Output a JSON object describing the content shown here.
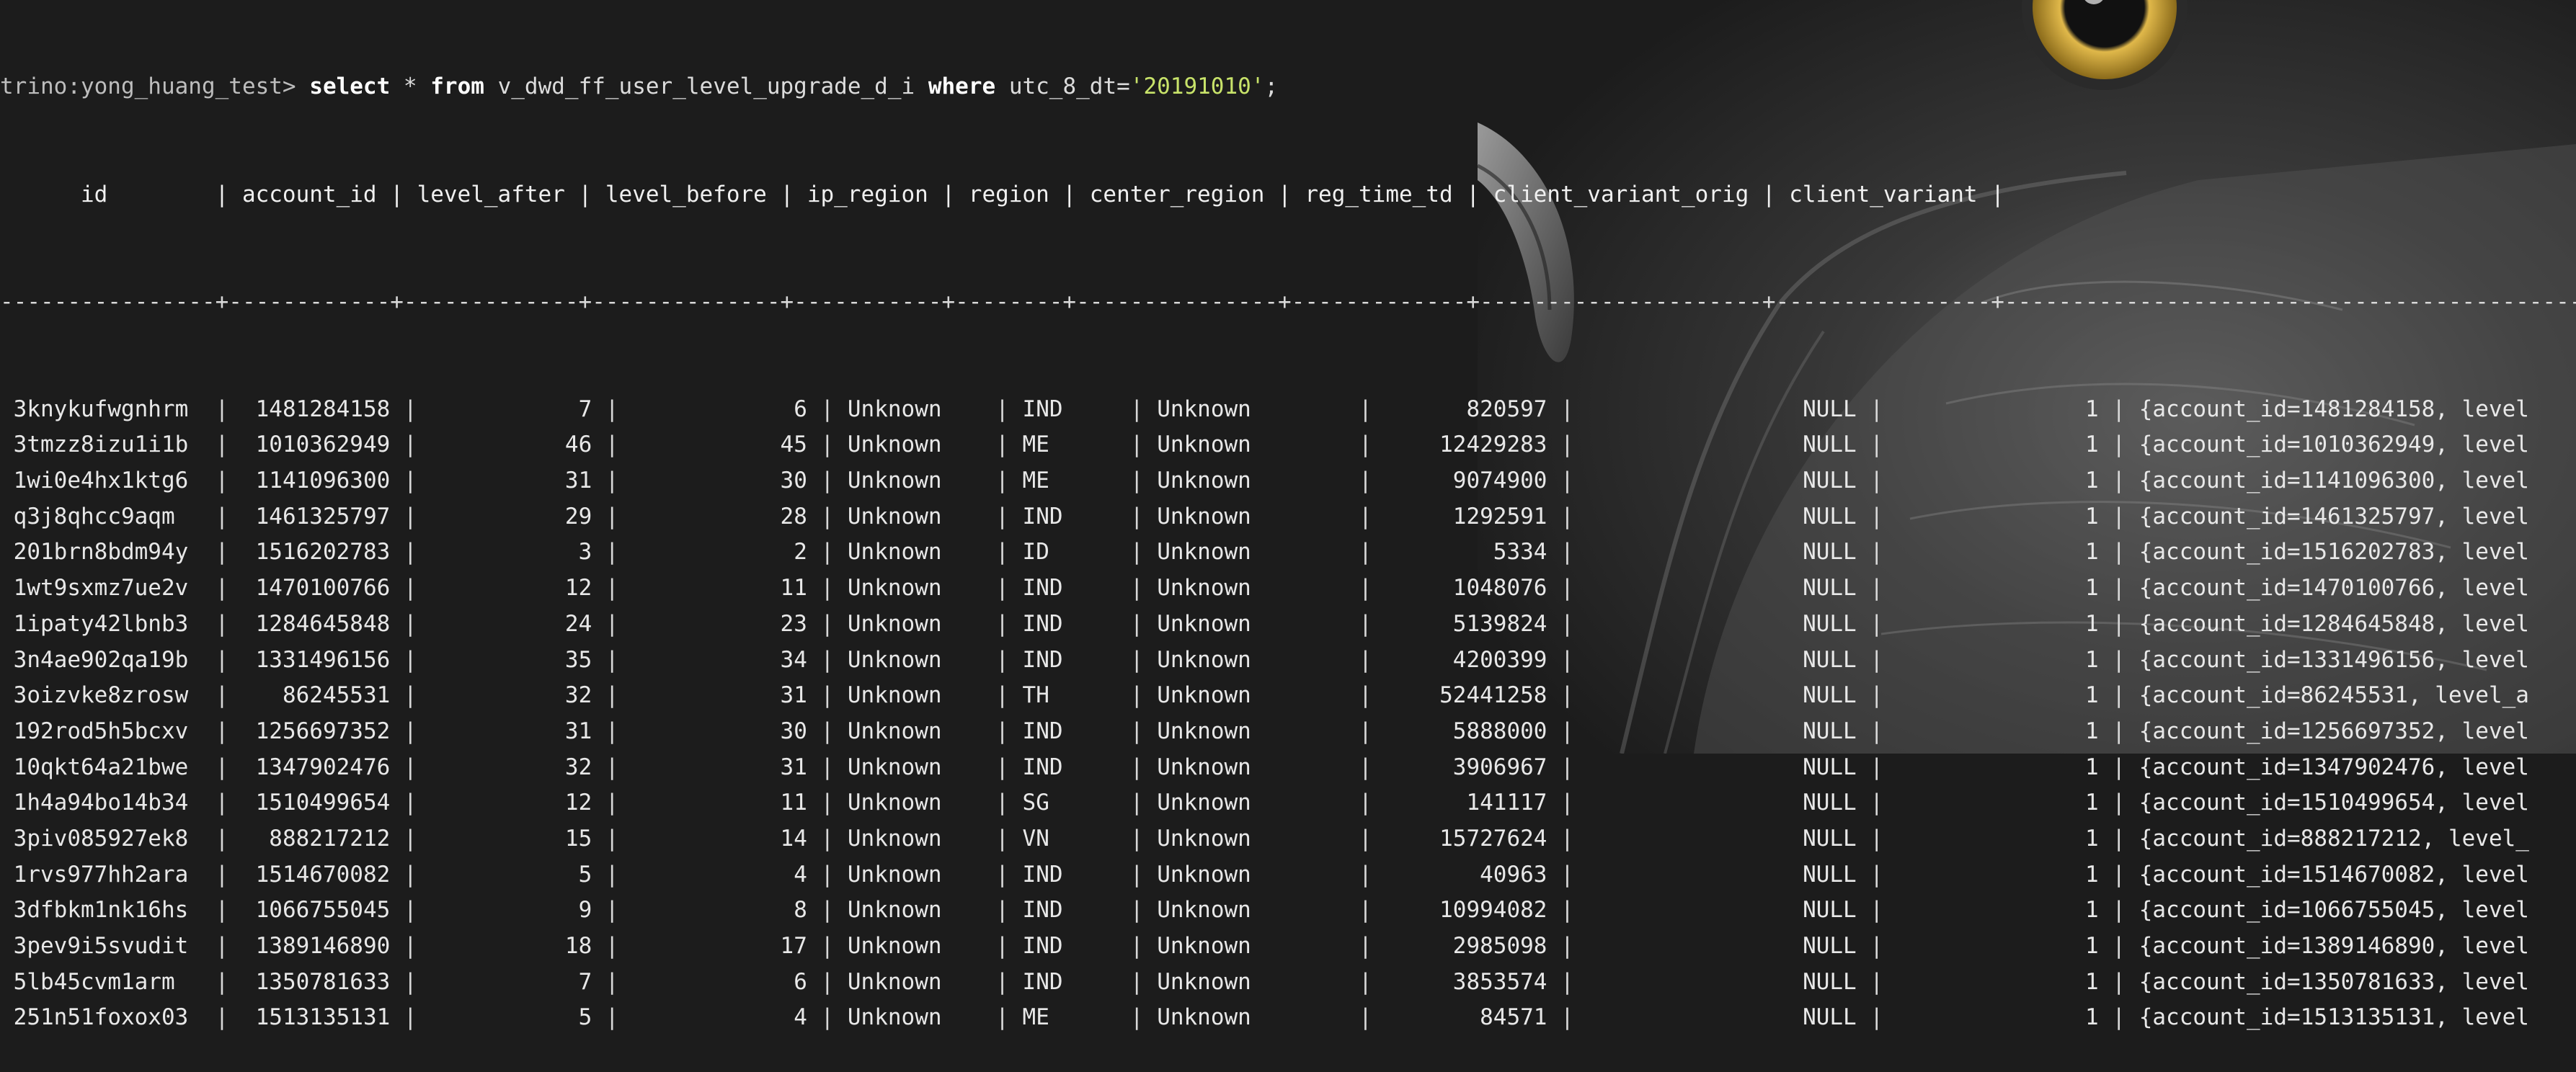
{
  "prompt": "trino:yong_huang_test>",
  "query": {
    "kw_select": "select",
    "star_from_text": " * ",
    "kw_from": "from",
    "table": " v_dwd_ff_user_level_upgrade_d_i ",
    "kw_where": "where",
    "condition": " utc_8_dt=",
    "value": "'20191010'",
    "terminator": ";"
  },
  "table": {
    "columns": [
      "id",
      "account_id",
      "level_after",
      "level_before",
      "ip_region",
      "region",
      "center_region",
      "reg_time_td",
      "client_variant_orig",
      "client_variant"
    ],
    "header_line": "      id        | account_id | level_after | level_before | ip_region | region | center_region | reg_time_td | client_variant_orig | client_variant |",
    "separator_line": "----------------+------------+-------------+--------------+-----------+--------+---------------+-------------+---------------------+----------------+-----------------------------------------------------------",
    "rows": [
      [
        "3knykufwgnhrm",
        "1481284158",
        "7",
        "6",
        "Unknown",
        "IND",
        "Unknown",
        "820597",
        "NULL",
        "1",
        "{account_id=1481284158, level"
      ],
      [
        "3tmzz8izu1i1b",
        "1010362949",
        "46",
        "45",
        "Unknown",
        "ME",
        "Unknown",
        "12429283",
        "NULL",
        "1",
        "{account_id=1010362949, level"
      ],
      [
        "1wi0e4hx1ktg6",
        "1141096300",
        "31",
        "30",
        "Unknown",
        "ME",
        "Unknown",
        "9074900",
        "NULL",
        "1",
        "{account_id=1141096300, level"
      ],
      [
        "q3j8qhcc9aqm",
        "1461325797",
        "29",
        "28",
        "Unknown",
        "IND",
        "Unknown",
        "1292591",
        "NULL",
        "1",
        "{account_id=1461325797, level"
      ],
      [
        "201brn8bdm94y",
        "1516202783",
        "3",
        "2",
        "Unknown",
        "ID",
        "Unknown",
        "5334",
        "NULL",
        "1",
        "{account_id=1516202783, level"
      ],
      [
        "1wt9sxmz7ue2v",
        "1470100766",
        "12",
        "11",
        "Unknown",
        "IND",
        "Unknown",
        "1048076",
        "NULL",
        "1",
        "{account_id=1470100766, level"
      ],
      [
        "1ipaty42lbnb3",
        "1284645848",
        "24",
        "23",
        "Unknown",
        "IND",
        "Unknown",
        "5139824",
        "NULL",
        "1",
        "{account_id=1284645848, level"
      ],
      [
        "3n4ae902qa19b",
        "1331496156",
        "35",
        "34",
        "Unknown",
        "IND",
        "Unknown",
        "4200399",
        "NULL",
        "1",
        "{account_id=1331496156, level"
      ],
      [
        "3oizvke8zrosw",
        "86245531",
        "32",
        "31",
        "Unknown",
        "TH",
        "Unknown",
        "52441258",
        "NULL",
        "1",
        "{account_id=86245531, level_a"
      ],
      [
        "192rod5h5bcxv",
        "1256697352",
        "31",
        "30",
        "Unknown",
        "IND",
        "Unknown",
        "5888000",
        "NULL",
        "1",
        "{account_id=1256697352, level"
      ],
      [
        "10qkt64a21bwe",
        "1347902476",
        "32",
        "31",
        "Unknown",
        "IND",
        "Unknown",
        "3906967",
        "NULL",
        "1",
        "{account_id=1347902476, level"
      ],
      [
        "1h4a94bo14b34",
        "1510499654",
        "12",
        "11",
        "Unknown",
        "SG",
        "Unknown",
        "141117",
        "NULL",
        "1",
        "{account_id=1510499654, level"
      ],
      [
        "3piv085927ek8",
        "888217212",
        "15",
        "14",
        "Unknown",
        "VN",
        "Unknown",
        "15727624",
        "NULL",
        "1",
        "{account_id=888217212, level_"
      ],
      [
        "1rvs977hh2ara",
        "1514670082",
        "5",
        "4",
        "Unknown",
        "IND",
        "Unknown",
        "40963",
        "NULL",
        "1",
        "{account_id=1514670082, level"
      ],
      [
        "3dfbkm1nk16hs",
        "1066755045",
        "9",
        "8",
        "Unknown",
        "IND",
        "Unknown",
        "10994082",
        "NULL",
        "1",
        "{account_id=1066755045, level"
      ],
      [
        "3pev9i5svudit",
        "1389146890",
        "18",
        "17",
        "Unknown",
        "IND",
        "Unknown",
        "2985098",
        "NULL",
        "1",
        "{account_id=1389146890, level"
      ],
      [
        "5lb45cvm1arm",
        "1350781633",
        "7",
        "6",
        "Unknown",
        "IND",
        "Unknown",
        "3853574",
        "NULL",
        "1",
        "{account_id=1350781633, level"
      ],
      [
        "251n51foxox03",
        "1513135131",
        "5",
        "4",
        "Unknown",
        "ME",
        "Unknown",
        "84571",
        "NULL",
        "1",
        "{account_id=1513135131, level"
      ]
    ]
  },
  "colors": {
    "background": "#1c1c1c",
    "text": "#e6e6e6",
    "string_literal": "#c8e36a",
    "owl_eye": "#c9a227"
  }
}
